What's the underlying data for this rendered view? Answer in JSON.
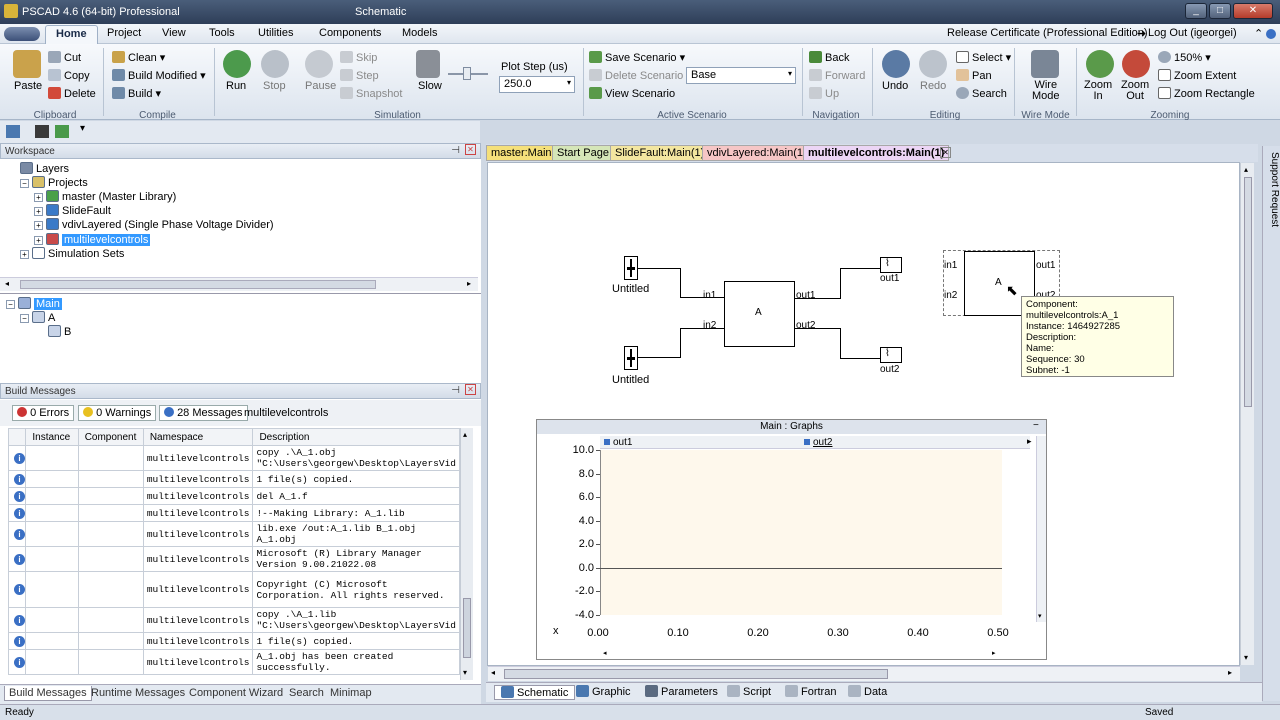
{
  "title_bar": {
    "app": "PSCAD 4.6 (64-bit) Professional",
    "context": "Schematic"
  },
  "menu": {
    "tabs": [
      "Home",
      "Project",
      "View",
      "Tools",
      "Utilities",
      "Components",
      "Models"
    ],
    "release": "Release Certificate (Professional Edition)",
    "logout": "Log Out (igeorgei)"
  },
  "ribbon": {
    "clipboard": {
      "paste": "Paste",
      "cut": "Cut",
      "copy": "Copy",
      "delete": "Delete",
      "group": "Clipboard"
    },
    "compile": {
      "clean": "Clean",
      "build_modified": "Build Modified",
      "build": "Build",
      "group": "Compile"
    },
    "simulation": {
      "run": "Run",
      "stop": "Stop",
      "pause": "Pause",
      "skip": "Skip",
      "step": "Step",
      "snapshot": "Snapshot",
      "slow": "Slow",
      "plot_step_label": "Plot Step (us)",
      "plot_step_value": "250.0",
      "group": "Simulation"
    },
    "scenario": {
      "save": "Save Scenario",
      "delete": "Delete Scenario",
      "view": "View Scenario",
      "base": "Base",
      "group": "Active Scenario"
    },
    "navigation": {
      "back": "Back",
      "forward": "Forward",
      "up": "Up",
      "group": "Navigation"
    },
    "editing": {
      "undo": "Undo",
      "redo": "Redo",
      "select": "Select",
      "pan": "Pan",
      "search": "Search",
      "group": "Editing"
    },
    "wire": {
      "label1": "Wire",
      "label2": "Mode",
      "group": "Wire Mode"
    },
    "zoom": {
      "in1": "Zoom",
      "in2": "In",
      "out1": "Zoom",
      "out2": "Out",
      "level": "150%",
      "extent": "Zoom Extent",
      "rectangle": "Zoom Rectangle",
      "group": "Zooming"
    }
  },
  "workspace": {
    "title": "Workspace",
    "layers": "Layers",
    "projects": "Projects",
    "items": [
      "master (Master Library)",
      "SlideFault",
      "vdivLayered (Single Phase Voltage Divider)",
      "multilevelcontrols"
    ],
    "simulation_sets": "Simulation Sets"
  },
  "hierarchy": {
    "main": "Main",
    "a": "A",
    "b": "B"
  },
  "build_messages": {
    "title": "Build Messages",
    "errors": "0 Errors",
    "warnings": "0 Warnings",
    "messages": "28 Messages",
    "project": "multilevelcontrols",
    "columns": [
      "Instance",
      "Component",
      "Namespace",
      "Description"
    ],
    "rows": [
      {
        "ns": "multilevelcontrols",
        "desc": "copy .\\A_1.obj \"C:\\Users\\georgew\\Desktop\\LayersVid"
      },
      {
        "ns": "multilevelcontrols",
        "desc": "1 file(s) copied."
      },
      {
        "ns": "multilevelcontrols",
        "desc": "del A_1.f"
      },
      {
        "ns": "multilevelcontrols",
        "desc": "!--Making Library: A_1.lib"
      },
      {
        "ns": "multilevelcontrols",
        "desc": "lib.exe /out:A_1.lib  B_1.obj A_1.obj"
      },
      {
        "ns": "multilevelcontrols",
        "desc": "Microsoft (R) Library Manager Version 9.00.21022.08"
      },
      {
        "ns": "multilevelcontrols",
        "desc": "Copyright (C) Microsoft Corporation.  All rights reserved."
      },
      {
        "ns": "multilevelcontrols",
        "desc": "copy .\\A_1.lib \"C:\\Users\\georgew\\Desktop\\LayersVid"
      },
      {
        "ns": "multilevelcontrols",
        "desc": "1 file(s) copied."
      },
      {
        "ns": "multilevelcontrols",
        "desc": "A_1.obj has been created successfully."
      }
    ],
    "tabs": [
      "Build Messages",
      "Runtime Messages",
      "Component Wizard",
      "Search",
      "Minimap"
    ]
  },
  "doc_tabs": [
    "master:Main",
    "Start Page",
    "SlideFault:Main(1)",
    "vdivLayered:Main(1)",
    "multilevelcontrols:Main(1)"
  ],
  "schematic": {
    "untitled1": "Untitled",
    "untitled2": "Untitled",
    "in1": "in1",
    "in2": "in2",
    "block": "A",
    "out1": "out1",
    "out2": "out2",
    "out1_lbl": "out1",
    "out2_lbl": "out2",
    "in1b": "in1",
    "in2b": "in2",
    "blockb": "A",
    "out1b": "out1",
    "out2b": "out2",
    "tooltip": {
      "component": "Component: multilevelcontrols:A_1",
      "instance": "Instance: 1464927285",
      "description": "Description:",
      "name": "Name:",
      "sequence": "Sequence: 30",
      "subnet": "Subnet: -1"
    }
  },
  "graph": {
    "title": "Main : Graphs",
    "series": [
      "out1",
      "out2"
    ],
    "x_axis_label": "x",
    "yticks": [
      "10.0",
      "8.0",
      "6.0",
      "4.0",
      "2.0",
      "0.0",
      "-2.0",
      "-4.0"
    ],
    "xticks": [
      "0.00",
      "0.10",
      "0.20",
      "0.30",
      "0.40",
      "0.50"
    ]
  },
  "bottom_tabs": [
    "Schematic",
    "Graphic",
    "Parameters",
    "Script",
    "Fortran",
    "Data"
  ],
  "side_tab": "Support Request",
  "status": {
    "left": "Ready",
    "right": "Saved"
  }
}
